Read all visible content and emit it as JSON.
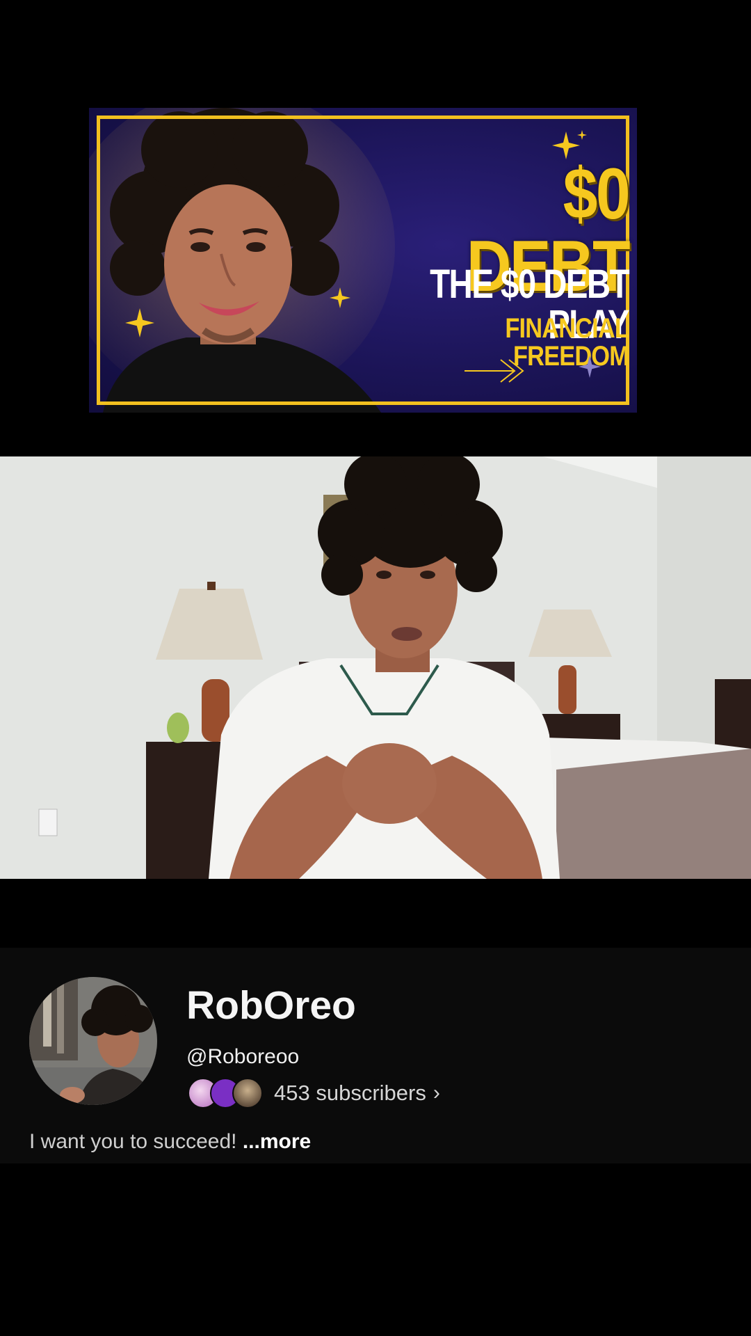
{
  "thumbnail": {
    "headline": "$0 DEBT",
    "subline1": "THE $0 DEBT PLAY",
    "subline2": "FINANCIAL FREEDOM",
    "colors": {
      "accent": "#f6c81f",
      "background": "#1b1456"
    },
    "icons": [
      "sparkle-icon",
      "arrow-right-icon"
    ]
  },
  "video": {
    "description": "video frame"
  },
  "channel": {
    "name": "RobOreo",
    "handle": "@Roboreoo",
    "subscribers": "453 subscribers",
    "chevron": "›",
    "description": "I want you to succeed!",
    "more": "...more"
  }
}
